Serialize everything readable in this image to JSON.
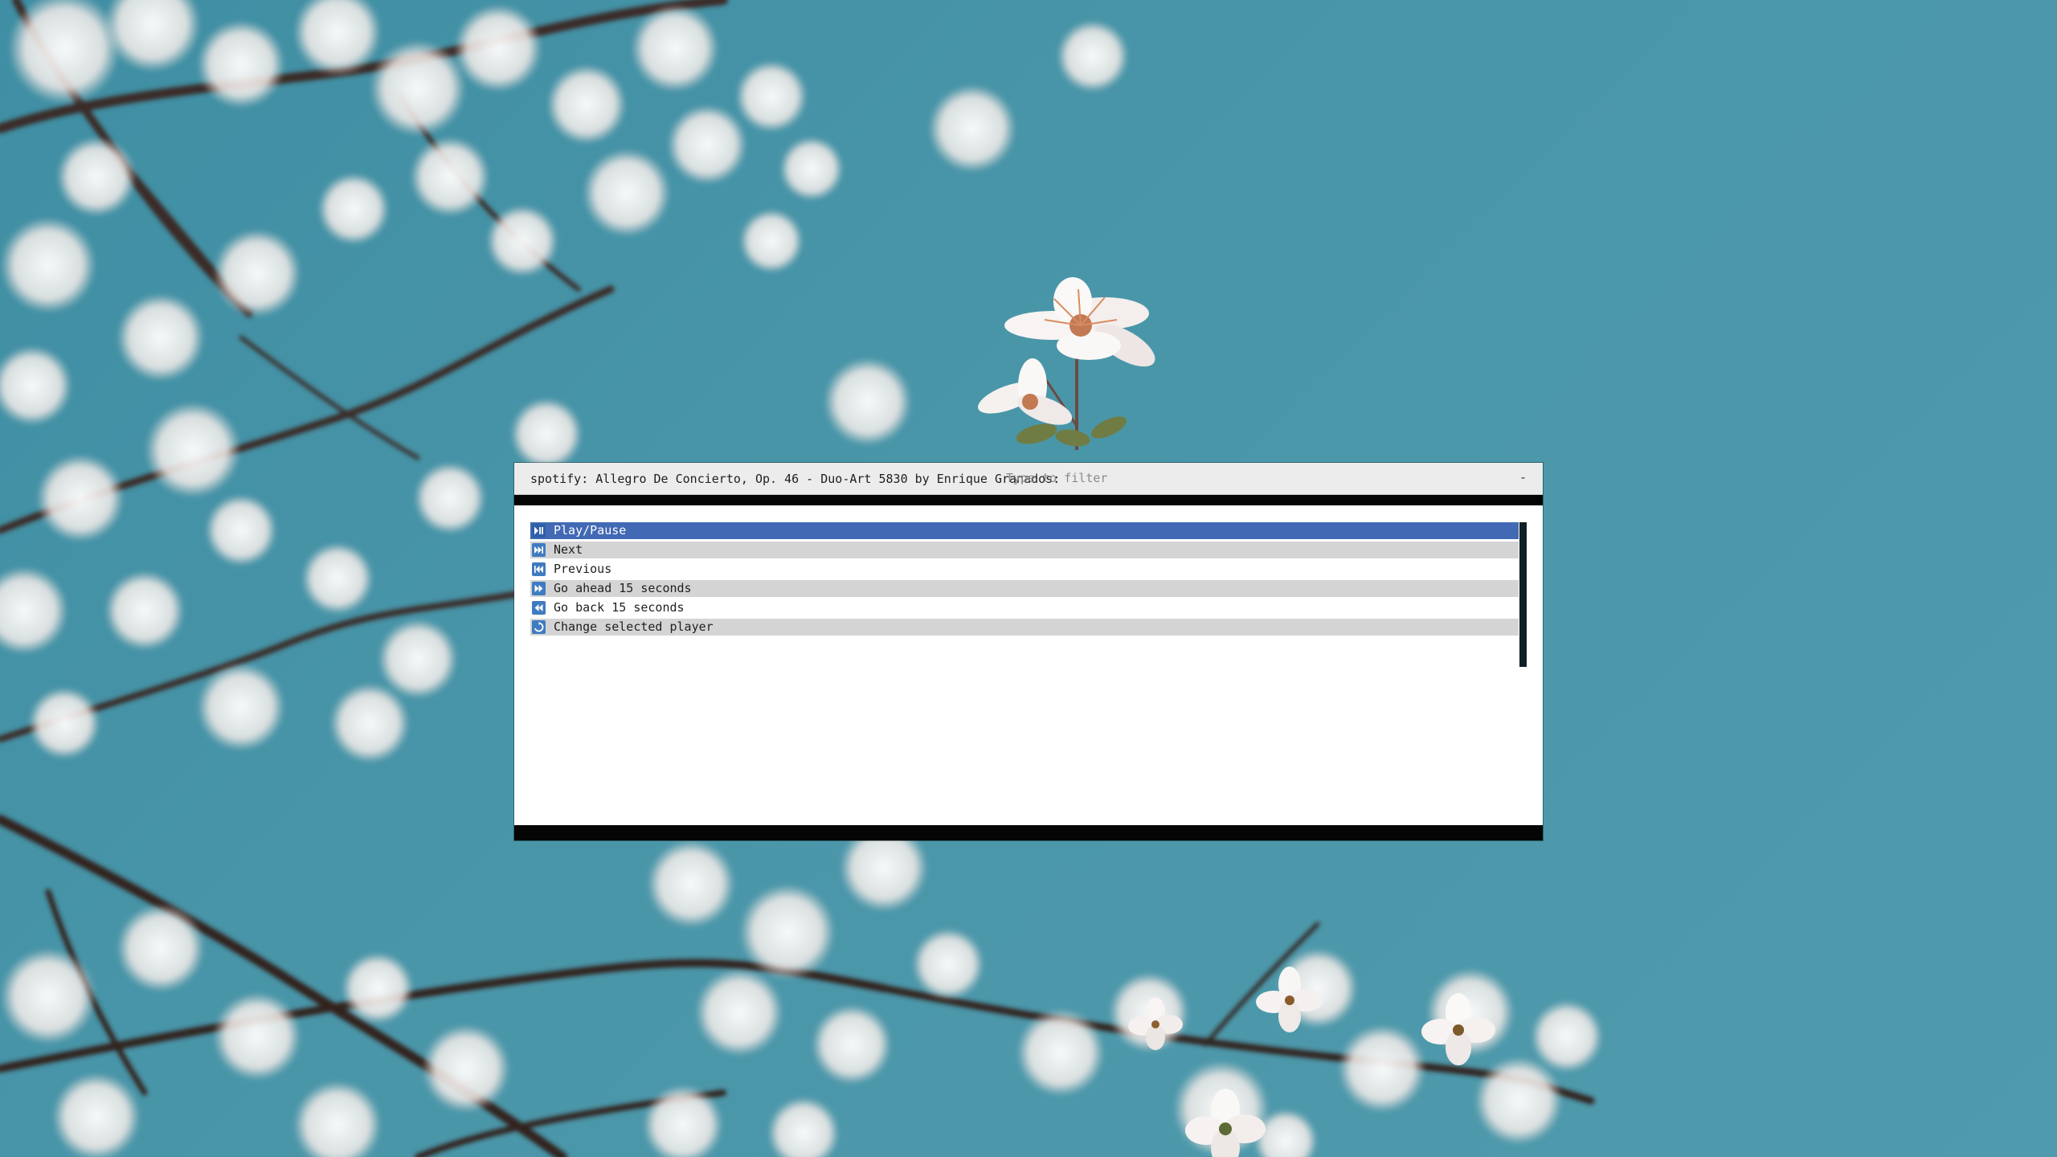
{
  "launcher": {
    "prompt": "spotify: Allegro De Concierto, Op. 46 - Duo-Art 5830 by Enrique Granados:",
    "filter_placeholder": "Type to filter",
    "filter_value": "",
    "minimize_mark": "-",
    "entries": [
      {
        "label": "Play/Pause",
        "icon": "play-pause-icon",
        "state": "selected"
      },
      {
        "label": "Next",
        "icon": "skip-next-icon",
        "state": "alt"
      },
      {
        "label": "Previous",
        "icon": "skip-previous-icon",
        "state": "normal"
      },
      {
        "label": "Go ahead 15 seconds",
        "icon": "seek-forward-icon",
        "state": "alt"
      },
      {
        "label": "Go back 15 seconds",
        "icon": "seek-backward-icon",
        "state": "normal"
      },
      {
        "label": "Change selected player",
        "icon": "switch-player-icon",
        "state": "alt"
      }
    ]
  },
  "theme": {
    "selected_color": "#4169b4",
    "alt_row_color": "#d4d4d4",
    "icon_color": "#3f7bc0",
    "wallpaper_sky": "#4a96a9"
  }
}
